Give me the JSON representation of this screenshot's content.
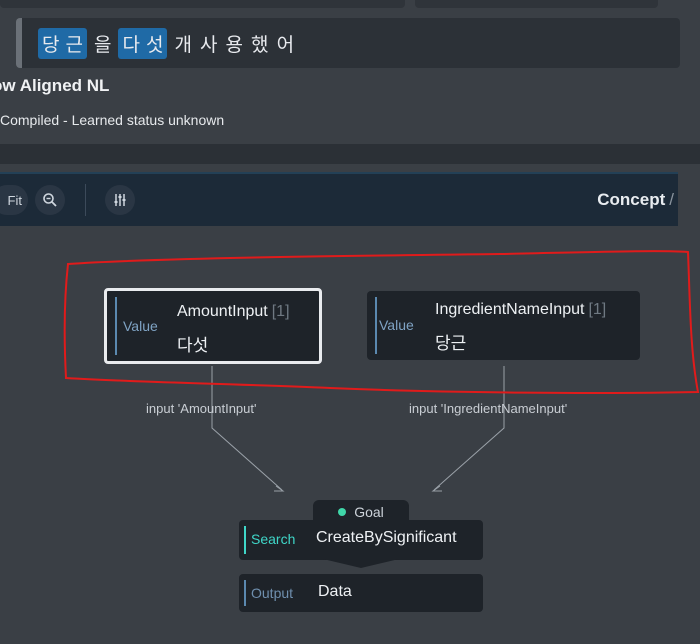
{
  "utterance": {
    "tokens": [
      {
        "text": "당 근",
        "highlighted": true
      },
      {
        "text": "을",
        "highlighted": false
      },
      {
        "text": "다 섯",
        "highlighted": true
      },
      {
        "text": "개 사 용 했 어",
        "highlighted": false
      }
    ]
  },
  "aligned_nl": {
    "title": "ow Aligned NL",
    "status": "Compiled - Learned status unknown"
  },
  "toolbar": {
    "fit_label": "Fit",
    "zoom_icon": "zoom-icon",
    "settings_icon": "sliders-icon",
    "breadcrumb": "Concept",
    "breadcrumb_sep": "/"
  },
  "graph": {
    "amount_node": {
      "kind": "Value",
      "name": "AmountInput",
      "count": "[1]",
      "value": "다섯"
    },
    "ingredient_node": {
      "kind": "Value",
      "name": "IngredientNameInput",
      "count": "[1]",
      "value": "당근"
    },
    "edge_amount": "input 'AmountInput'",
    "edge_ingredient": "input 'IngredientNameInput'",
    "goal": {
      "label": "Goal",
      "dot_color": "#3fd6a8"
    },
    "search_node": {
      "kind": "Search",
      "name": "CreateBySignificant"
    },
    "output_node": {
      "kind": "Output",
      "name": "Data"
    }
  },
  "colors": {
    "highlight": "#1f6aa6",
    "annotation_outline": "#e01b1b",
    "selected_border": "#e9ebee"
  }
}
